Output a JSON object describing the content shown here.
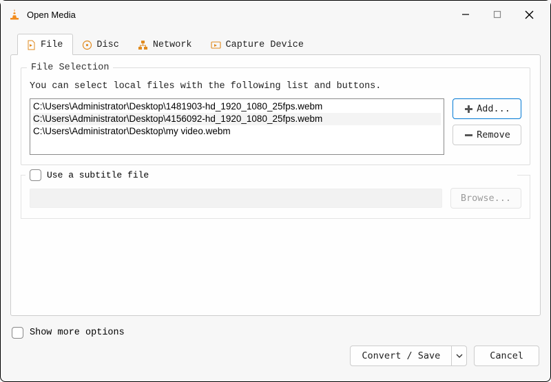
{
  "window": {
    "title": "Open Media"
  },
  "tabs": {
    "file": "File",
    "disc": "Disc",
    "network": "Network",
    "capture": "Capture Device"
  },
  "fileSelection": {
    "legend": "File Selection",
    "desc": "You can select local files with the following list and buttons.",
    "files": [
      "C:\\Users\\Administrator\\Desktop\\1481903-hd_1920_1080_25fps.webm",
      "C:\\Users\\Administrator\\Desktop\\4156092-hd_1920_1080_25fps.webm",
      "C:\\Users\\Administrator\\Desktop\\my video.webm"
    ],
    "addLabel": "Add...",
    "removeLabel": "Remove"
  },
  "subtitle": {
    "label": "Use a subtitle file",
    "browse": "Browse..."
  },
  "bottom": {
    "showMore": "Show more options",
    "convert": "Convert / Save",
    "cancel": "Cancel"
  }
}
